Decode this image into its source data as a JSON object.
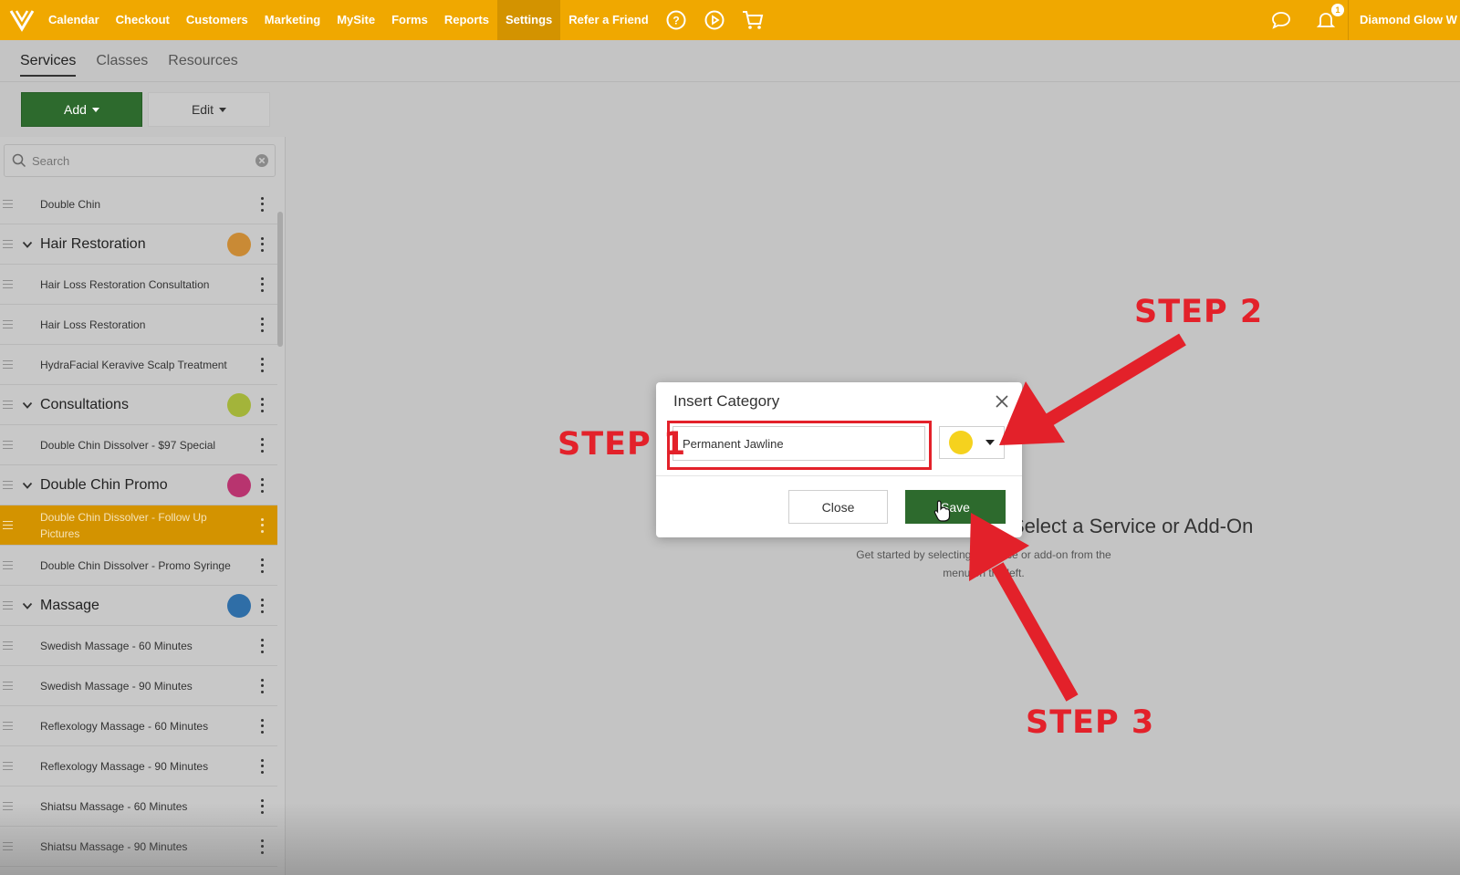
{
  "topnav": {
    "items": [
      "Calendar",
      "Checkout",
      "Customers",
      "Marketing",
      "MySite",
      "Forms",
      "Reports",
      "Settings",
      "Refer a Friend"
    ],
    "active": "Settings",
    "notification_count": "1",
    "user_name": "Diamond Glow W",
    "brand_color": "#f0a800"
  },
  "subtabs": [
    "Services",
    "Classes",
    "Resources"
  ],
  "toolbar": {
    "add_label": "Add",
    "edit_label": "Edit"
  },
  "search": {
    "placeholder": "Search"
  },
  "list": [
    {
      "label": "Double Chin",
      "type": "item"
    },
    {
      "label": "Hair Restoration",
      "type": "category",
      "color": "#c98a35"
    },
    {
      "label": "Hair Loss Restoration Consultation",
      "type": "item"
    },
    {
      "label": "Hair Loss Restoration",
      "type": "item"
    },
    {
      "label": "HydraFacial Keravive Scalp Treatment",
      "type": "item"
    },
    {
      "label": "Consultations",
      "type": "category",
      "color": "#a3b43a"
    },
    {
      "label": "Double Chin Dissolver - $97 Special",
      "type": "item"
    },
    {
      "label": "Double Chin Promo",
      "type": "category",
      "color": "#b8346f"
    },
    {
      "label": "Double Chin Dissolver - Follow Up Pictures",
      "type": "item",
      "selected": true
    },
    {
      "label": "Double Chin Dissolver - Promo Syringe",
      "type": "item"
    },
    {
      "label": "Massage",
      "type": "category",
      "color": "#2f6ea7"
    },
    {
      "label": "Swedish Massage - 60 Minutes",
      "type": "item"
    },
    {
      "label": "Swedish Massage - 90 Minutes",
      "type": "item"
    },
    {
      "label": "Reflexology Massage - 60 Minutes",
      "type": "item"
    },
    {
      "label": "Reflexology Massage - 90 Minutes",
      "type": "item"
    },
    {
      "label": "Shiatsu Massage - 60 Minutes",
      "type": "item"
    },
    {
      "label": "Shiatsu Massage - 90 Minutes",
      "type": "item"
    }
  ],
  "empty_state": {
    "title": "Select a Service or Add-On",
    "description": "Get started by selecting a service or add-on from the menu on the left."
  },
  "dialog": {
    "title": "Insert Category",
    "input_value": "Permanent Jawline",
    "color_value": "#f5d21e",
    "close_label": "Close",
    "save_label": "Save"
  },
  "annotations": {
    "step1": "STEP 1",
    "step2": "STEP 2",
    "step3": "STEP 3",
    "color": "#e3212a"
  }
}
